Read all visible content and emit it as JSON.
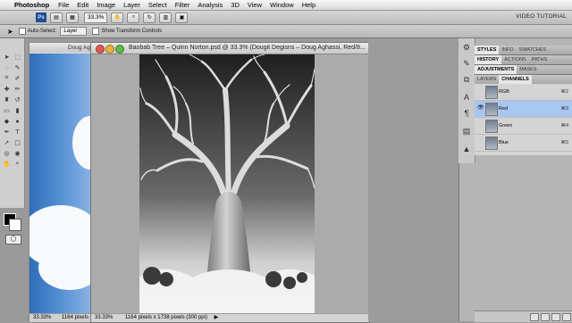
{
  "menubar": {
    "apple_icon": "apple-icon",
    "app_name": "Photoshop",
    "items": [
      "File",
      "Edit",
      "Image",
      "Layer",
      "Select",
      "Filter",
      "Analysis",
      "3D",
      "View",
      "Window",
      "Help"
    ]
  },
  "appbar": {
    "badge": "Ps",
    "zoom": "33.3%",
    "workspace": "VIDEO TUTORIAL"
  },
  "options": {
    "auto_select_label": "Auto-Select:",
    "auto_select_value": "Layer",
    "transform_label": "Show Transform Controls"
  },
  "back_document": {
    "title": "Doug Ag",
    "zoom": "33.33%",
    "status": "1164 pixels"
  },
  "document": {
    "title": "Baobab Tree – Quinn Norton.psd @ 33.3% (Dougit Degisns – Doug Aghassi, Red/8...",
    "zoom": "33.33%",
    "status": "1164 pixels x 1738 pixels (300 ppi)"
  },
  "panels": {
    "row1_tabs": [
      "STYLES",
      "INFO",
      "SWATCHES"
    ],
    "row2_tabs": [
      "HISTORY",
      "ACTIONS",
      "PATHS"
    ],
    "row3_tabs": [
      "ADJUSTMENTS",
      "MASKS"
    ],
    "row4_tabs": [
      "LAYERS",
      "CHANNELS"
    ],
    "channels": [
      {
        "name": "RGB",
        "shortcut": "⌘2"
      },
      {
        "name": "Red",
        "shortcut": "⌘3"
      },
      {
        "name": "Green",
        "shortcut": "⌘4"
      },
      {
        "name": "Blue",
        "shortcut": "⌘5"
      }
    ]
  }
}
